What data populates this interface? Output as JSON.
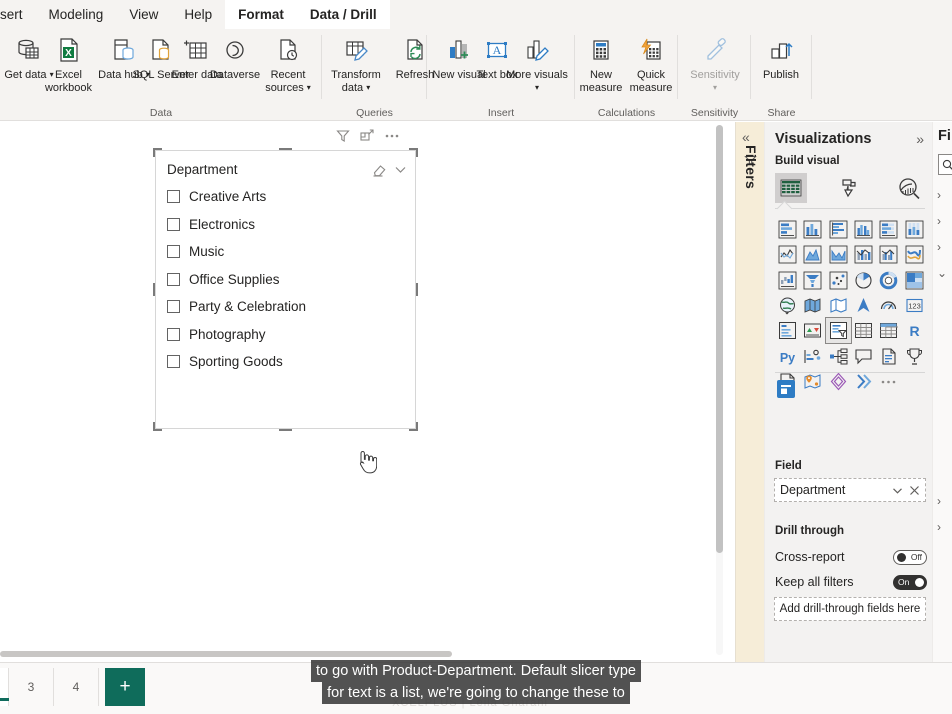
{
  "ribbon": {
    "tabs": [
      {
        "label": "sert",
        "contextual": false,
        "clipped": true
      },
      {
        "label": "Modeling",
        "contextual": false
      },
      {
        "label": "View",
        "contextual": false
      },
      {
        "label": "Help",
        "contextual": false
      },
      {
        "label": "Format",
        "contextual": true
      },
      {
        "label": "Data / Drill",
        "contextual": true
      }
    ],
    "groups": [
      {
        "name": "Data",
        "buttons": [
          {
            "label": "Get data",
            "icon": "get-data-icon",
            "dropdown": true
          },
          {
            "label": "Excel workbook",
            "icon": "excel-workbook-icon",
            "dropdown": false
          },
          {
            "label": "Data hub",
            "icon": "data-hub-icon",
            "dropdown": true
          },
          {
            "label": "SQL Server",
            "icon": "sql-server-icon",
            "dropdown": false
          },
          {
            "label": "Enter data",
            "icon": "enter-data-icon",
            "dropdown": false
          },
          {
            "label": "Dataverse",
            "icon": "dataverse-icon",
            "dropdown": false
          },
          {
            "label": "Recent sources",
            "icon": "recent-sources-icon",
            "dropdown": true
          }
        ]
      },
      {
        "name": "Queries",
        "buttons": [
          {
            "label": "Transform data",
            "icon": "transform-data-icon",
            "dropdown": true
          },
          {
            "label": "Refresh",
            "icon": "refresh-icon",
            "dropdown": false
          }
        ]
      },
      {
        "name": "Insert",
        "buttons": [
          {
            "label": "New visual",
            "icon": "new-visual-icon",
            "dropdown": false
          },
          {
            "label": "Text box",
            "icon": "text-box-icon",
            "dropdown": false
          },
          {
            "label": "More visuals",
            "icon": "more-visuals-icon",
            "dropdown": true
          }
        ]
      },
      {
        "name": "Calculations",
        "buttons": [
          {
            "label": "New measure",
            "icon": "new-measure-icon",
            "dropdown": false
          },
          {
            "label": "Quick measure",
            "icon": "quick-measure-icon",
            "dropdown": false
          }
        ]
      },
      {
        "name": "Sensitivity",
        "buttons": [
          {
            "label": "Sensitivity",
            "icon": "sensitivity-icon",
            "dropdown": true,
            "disabled": true
          }
        ]
      },
      {
        "name": "Share",
        "buttons": [
          {
            "label": "Publish",
            "icon": "publish-icon",
            "dropdown": false
          }
        ]
      }
    ]
  },
  "canvas": {
    "visual_toolbar": [
      {
        "name": "filter-icon",
        "title": "Filters"
      },
      {
        "name": "focus-mode-icon",
        "title": "Focus mode"
      },
      {
        "name": "more-options-icon",
        "title": "More options"
      }
    ],
    "slicer": {
      "title": "Department",
      "clear_icon": "eraser-icon",
      "expand_icon": "chevron-down-icon",
      "items": [
        {
          "label": "Creative Arts",
          "checked": false
        },
        {
          "label": "Electronics",
          "checked": false
        },
        {
          "label": "Music",
          "checked": false
        },
        {
          "label": "Office Supplies",
          "checked": false
        },
        {
          "label": "Party & Celebration",
          "checked": false
        },
        {
          "label": "Photography",
          "checked": false
        },
        {
          "label": "Sporting Goods",
          "checked": false
        }
      ]
    }
  },
  "filters_pane": {
    "collapse_icon": "chevron-double-left-icon",
    "filter_icon": "filter-funnel-icon",
    "label": "Filters"
  },
  "visualizations": {
    "title": "Visualizations",
    "expand_icon": "chevron-double-right-icon",
    "build_visual_label": "Build visual",
    "build_tabs": [
      {
        "name": "build-visual-tab",
        "icon": "fields-grid-icon",
        "selected": true
      },
      {
        "name": "format-visual-tab",
        "icon": "paint-roller-icon",
        "selected": false
      },
      {
        "name": "analytics-tab",
        "icon": "analytics-magnifier-icon",
        "selected": false
      }
    ],
    "gallery": [
      [
        "stacked-bar-chart",
        "stacked-column-chart",
        "clustered-bar-chart",
        "clustered-column-chart",
        "hundred-percent-stacked-bar-chart",
        "hundred-percent-stacked-column-chart"
      ],
      [
        "line-chart",
        "area-chart",
        "stacked-area-chart",
        "line-and-stacked-column-chart",
        "line-and-clustered-column-chart",
        "ribbon-chart"
      ],
      [
        "waterfall-chart",
        "funnel-chart",
        "scatter-chart",
        "pie-chart",
        "donut-chart",
        "treemap"
      ],
      [
        "map",
        "filled-map",
        "shape-map",
        "azure-map",
        "gauge",
        "card"
      ],
      [
        "multi-row-card",
        "kpi",
        "slicer",
        "table",
        "matrix",
        "r-script-visual"
      ],
      [
        "python-visual",
        "key-influencers",
        "decomposition-tree",
        "qna-visual",
        "smart-narrative",
        "metrics"
      ],
      [
        "paginated-report",
        "arcgis-map",
        "power-apps",
        "power-automate",
        "more-visuals",
        ""
      ]
    ],
    "selected_visual": "slicer",
    "get_more_visuals_icon": "get-more-visuals-icon",
    "field_well": {
      "label": "Field",
      "value": "Department",
      "dropdown_icon": "chevron-down-icon",
      "remove_icon": "close-icon"
    },
    "drill_through": {
      "label": "Drill through",
      "cross_report": {
        "label": "Cross-report",
        "state": "Off",
        "on": false
      },
      "keep_all_filters": {
        "label": "Keep all filters",
        "state": "On",
        "on": true
      },
      "dropzone": "Add drill-through fields here"
    }
  },
  "fields_pane": {
    "title": "Fi",
    "search_icon": "search-icon",
    "chevrons": [
      "chevron-right-icon",
      "chevron-right-icon",
      "chevron-right-icon",
      "chevron-down-icon",
      "chevron-right-icon",
      "chevron-right-icon"
    ]
  },
  "statusbar": {
    "page_tabs": [
      {
        "label": "3",
        "active": false
      },
      {
        "label": "4",
        "active": false
      }
    ],
    "add_page_label": "+"
  },
  "caption": {
    "line1": "to go with Product-Department. Default slicer type",
    "line2": "for text is a list, we're going to change these to"
  },
  "watermark": "XCELPLUS | Leila Gharani"
}
